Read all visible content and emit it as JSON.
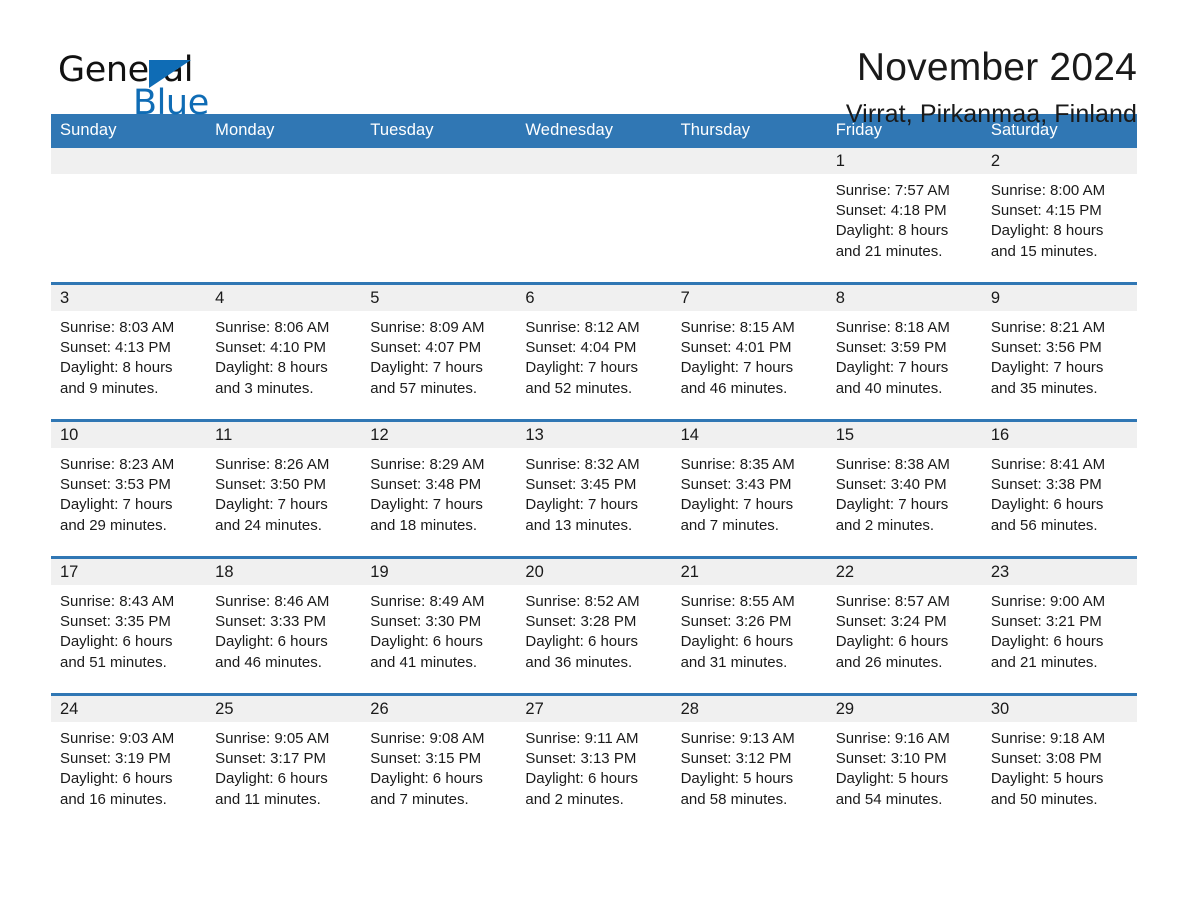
{
  "brand": {
    "name_part1": "General",
    "name_part2": "Blue",
    "accent_color": "#0f6cb5",
    "triangle_icon": "triangle-icon"
  },
  "header": {
    "title": "November 2024",
    "location": "Virrat, Pirkanmaa, Finland"
  },
  "calendar": {
    "header_background": "#3077b4",
    "daynum_background": "#f0f0f0",
    "weekday_headers": [
      "Sunday",
      "Monday",
      "Tuesday",
      "Wednesday",
      "Thursday",
      "Friday",
      "Saturday"
    ],
    "weeks": [
      [
        {
          "day": "",
          "sunrise": "",
          "sunset": "",
          "daylight_line1": "",
          "daylight_line2": ""
        },
        {
          "day": "",
          "sunrise": "",
          "sunset": "",
          "daylight_line1": "",
          "daylight_line2": ""
        },
        {
          "day": "",
          "sunrise": "",
          "sunset": "",
          "daylight_line1": "",
          "daylight_line2": ""
        },
        {
          "day": "",
          "sunrise": "",
          "sunset": "",
          "daylight_line1": "",
          "daylight_line2": ""
        },
        {
          "day": "",
          "sunrise": "",
          "sunset": "",
          "daylight_line1": "",
          "daylight_line2": ""
        },
        {
          "day": "1",
          "sunrise": "Sunrise: 7:57 AM",
          "sunset": "Sunset: 4:18 PM",
          "daylight_line1": "Daylight: 8 hours",
          "daylight_line2": "and 21 minutes."
        },
        {
          "day": "2",
          "sunrise": "Sunrise: 8:00 AM",
          "sunset": "Sunset: 4:15 PM",
          "daylight_line1": "Daylight: 8 hours",
          "daylight_line2": "and 15 minutes."
        }
      ],
      [
        {
          "day": "3",
          "sunrise": "Sunrise: 8:03 AM",
          "sunset": "Sunset: 4:13 PM",
          "daylight_line1": "Daylight: 8 hours",
          "daylight_line2": "and 9 minutes."
        },
        {
          "day": "4",
          "sunrise": "Sunrise: 8:06 AM",
          "sunset": "Sunset: 4:10 PM",
          "daylight_line1": "Daylight: 8 hours",
          "daylight_line2": "and 3 minutes."
        },
        {
          "day": "5",
          "sunrise": "Sunrise: 8:09 AM",
          "sunset": "Sunset: 4:07 PM",
          "daylight_line1": "Daylight: 7 hours",
          "daylight_line2": "and 57 minutes."
        },
        {
          "day": "6",
          "sunrise": "Sunrise: 8:12 AM",
          "sunset": "Sunset: 4:04 PM",
          "daylight_line1": "Daylight: 7 hours",
          "daylight_line2": "and 52 minutes."
        },
        {
          "day": "7",
          "sunrise": "Sunrise: 8:15 AM",
          "sunset": "Sunset: 4:01 PM",
          "daylight_line1": "Daylight: 7 hours",
          "daylight_line2": "and 46 minutes."
        },
        {
          "day": "8",
          "sunrise": "Sunrise: 8:18 AM",
          "sunset": "Sunset: 3:59 PM",
          "daylight_line1": "Daylight: 7 hours",
          "daylight_line2": "and 40 minutes."
        },
        {
          "day": "9",
          "sunrise": "Sunrise: 8:21 AM",
          "sunset": "Sunset: 3:56 PM",
          "daylight_line1": "Daylight: 7 hours",
          "daylight_line2": "and 35 minutes."
        }
      ],
      [
        {
          "day": "10",
          "sunrise": "Sunrise: 8:23 AM",
          "sunset": "Sunset: 3:53 PM",
          "daylight_line1": "Daylight: 7 hours",
          "daylight_line2": "and 29 minutes."
        },
        {
          "day": "11",
          "sunrise": "Sunrise: 8:26 AM",
          "sunset": "Sunset: 3:50 PM",
          "daylight_line1": "Daylight: 7 hours",
          "daylight_line2": "and 24 minutes."
        },
        {
          "day": "12",
          "sunrise": "Sunrise: 8:29 AM",
          "sunset": "Sunset: 3:48 PM",
          "daylight_line1": "Daylight: 7 hours",
          "daylight_line2": "and 18 minutes."
        },
        {
          "day": "13",
          "sunrise": "Sunrise: 8:32 AM",
          "sunset": "Sunset: 3:45 PM",
          "daylight_line1": "Daylight: 7 hours",
          "daylight_line2": "and 13 minutes."
        },
        {
          "day": "14",
          "sunrise": "Sunrise: 8:35 AM",
          "sunset": "Sunset: 3:43 PM",
          "daylight_line1": "Daylight: 7 hours",
          "daylight_line2": "and 7 minutes."
        },
        {
          "day": "15",
          "sunrise": "Sunrise: 8:38 AM",
          "sunset": "Sunset: 3:40 PM",
          "daylight_line1": "Daylight: 7 hours",
          "daylight_line2": "and 2 minutes."
        },
        {
          "day": "16",
          "sunrise": "Sunrise: 8:41 AM",
          "sunset": "Sunset: 3:38 PM",
          "daylight_line1": "Daylight: 6 hours",
          "daylight_line2": "and 56 minutes."
        }
      ],
      [
        {
          "day": "17",
          "sunrise": "Sunrise: 8:43 AM",
          "sunset": "Sunset: 3:35 PM",
          "daylight_line1": "Daylight: 6 hours",
          "daylight_line2": "and 51 minutes."
        },
        {
          "day": "18",
          "sunrise": "Sunrise: 8:46 AM",
          "sunset": "Sunset: 3:33 PM",
          "daylight_line1": "Daylight: 6 hours",
          "daylight_line2": "and 46 minutes."
        },
        {
          "day": "19",
          "sunrise": "Sunrise: 8:49 AM",
          "sunset": "Sunset: 3:30 PM",
          "daylight_line1": "Daylight: 6 hours",
          "daylight_line2": "and 41 minutes."
        },
        {
          "day": "20",
          "sunrise": "Sunrise: 8:52 AM",
          "sunset": "Sunset: 3:28 PM",
          "daylight_line1": "Daylight: 6 hours",
          "daylight_line2": "and 36 minutes."
        },
        {
          "day": "21",
          "sunrise": "Sunrise: 8:55 AM",
          "sunset": "Sunset: 3:26 PM",
          "daylight_line1": "Daylight: 6 hours",
          "daylight_line2": "and 31 minutes."
        },
        {
          "day": "22",
          "sunrise": "Sunrise: 8:57 AM",
          "sunset": "Sunset: 3:24 PM",
          "daylight_line1": "Daylight: 6 hours",
          "daylight_line2": "and 26 minutes."
        },
        {
          "day": "23",
          "sunrise": "Sunrise: 9:00 AM",
          "sunset": "Sunset: 3:21 PM",
          "daylight_line1": "Daylight: 6 hours",
          "daylight_line2": "and 21 minutes."
        }
      ],
      [
        {
          "day": "24",
          "sunrise": "Sunrise: 9:03 AM",
          "sunset": "Sunset: 3:19 PM",
          "daylight_line1": "Daylight: 6 hours",
          "daylight_line2": "and 16 minutes."
        },
        {
          "day": "25",
          "sunrise": "Sunrise: 9:05 AM",
          "sunset": "Sunset: 3:17 PM",
          "daylight_line1": "Daylight: 6 hours",
          "daylight_line2": "and 11 minutes."
        },
        {
          "day": "26",
          "sunrise": "Sunrise: 9:08 AM",
          "sunset": "Sunset: 3:15 PM",
          "daylight_line1": "Daylight: 6 hours",
          "daylight_line2": "and 7 minutes."
        },
        {
          "day": "27",
          "sunrise": "Sunrise: 9:11 AM",
          "sunset": "Sunset: 3:13 PM",
          "daylight_line1": "Daylight: 6 hours",
          "daylight_line2": "and 2 minutes."
        },
        {
          "day": "28",
          "sunrise": "Sunrise: 9:13 AM",
          "sunset": "Sunset: 3:12 PM",
          "daylight_line1": "Daylight: 5 hours",
          "daylight_line2": "and 58 minutes."
        },
        {
          "day": "29",
          "sunrise": "Sunrise: 9:16 AM",
          "sunset": "Sunset: 3:10 PM",
          "daylight_line1": "Daylight: 5 hours",
          "daylight_line2": "and 54 minutes."
        },
        {
          "day": "30",
          "sunrise": "Sunrise: 9:18 AM",
          "sunset": "Sunset: 3:08 PM",
          "daylight_line1": "Daylight: 5 hours",
          "daylight_line2": "and 50 minutes."
        }
      ]
    ]
  }
}
